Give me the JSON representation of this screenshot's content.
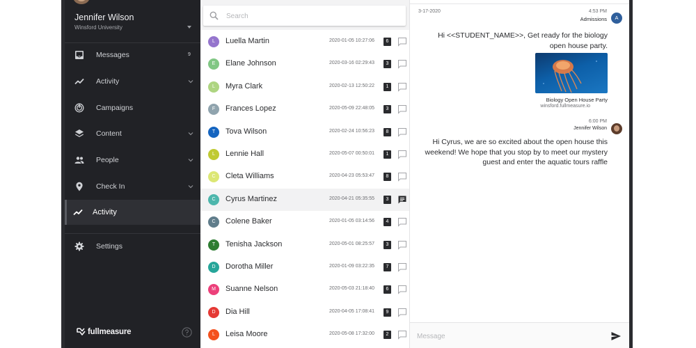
{
  "profile": {
    "name": "Jennifer Wilson",
    "organization": "Winsford University"
  },
  "sidebar": {
    "items": [
      {
        "label": "Messages",
        "icon": "inbox-icon",
        "badge": "9"
      },
      {
        "label": "Activity",
        "icon": "trend-icon",
        "has_chevron": true
      },
      {
        "label": "Campaigns",
        "icon": "campaign-icon"
      },
      {
        "label": "Content",
        "icon": "layers-icon",
        "has_chevron": true
      },
      {
        "label": "People",
        "icon": "people-icon",
        "has_chevron": true
      },
      {
        "label": "Check In",
        "icon": "location-pin-icon",
        "has_chevron": true
      },
      {
        "label": "Activity",
        "icon": "trend-icon",
        "active": true
      },
      {
        "label": "Settings",
        "icon": "gear-icon"
      }
    ],
    "logo_text": "fullmeasure"
  },
  "search": {
    "placeholder": "Search"
  },
  "contacts": [
    {
      "initial": "L",
      "name": "Luella Martin",
      "datetime": "2020-01-05 10:27:06",
      "count": "6",
      "color": "#9575cd"
    },
    {
      "initial": "E",
      "name": "Elane Johnson",
      "datetime": "2020-03-16 02:29:43",
      "count": "3",
      "color": "#81c784"
    },
    {
      "initial": "L",
      "name": "Myra Clark",
      "datetime": "2020-02-13 12:50:22",
      "count": "1",
      "color": "#aed581"
    },
    {
      "initial": "F",
      "name": "Frances Lopez",
      "datetime": "2020-05-09 22:48:05",
      "count": "3",
      "color": "#90a4ae"
    },
    {
      "initial": "T",
      "name": "Tova Wilson",
      "datetime": "2020-02-24 10:56:23",
      "count": "8",
      "color": "#1565c0"
    },
    {
      "initial": "L",
      "name": "Lennie Hall",
      "datetime": "2020-05-07 00:50:01",
      "count": "1",
      "color": "#c0ca33"
    },
    {
      "initial": "C",
      "name": "Cleta Williams",
      "datetime": "2020-04-23 05:53:47",
      "count": "8",
      "color": "#dce775"
    },
    {
      "initial": "C",
      "name": "Cyrus Martinez",
      "datetime": "2020-04-21 05:35:55",
      "count": "3",
      "color": "#4db6ac",
      "selected": true
    },
    {
      "initial": "C",
      "name": "Colene Baker",
      "datetime": "2020-01-05 03:14:56",
      "count": "4",
      "color": "#607d8b"
    },
    {
      "initial": "T",
      "name": "Tenisha Jackson",
      "datetime": "2020-05-01 08:25:57",
      "count": "3",
      "color": "#2e7d32"
    },
    {
      "initial": "D",
      "name": "Dorotha Miller",
      "datetime": "2020-01-09 03:22:35",
      "count": "7",
      "color": "#26a69a"
    },
    {
      "initial": "M",
      "name": "Suanne Nelson",
      "datetime": "2020-05-03 21:18:40",
      "count": "6",
      "color": "#ec407a"
    },
    {
      "initial": "D",
      "name": "Dia Hill",
      "datetime": "2020-04-05 17:08:41",
      "count": "9",
      "color": "#e53935"
    },
    {
      "initial": "L",
      "name": "Leisa Moore",
      "datetime": "2020-05-08 17:32:00",
      "count": "2",
      "color": "#f4511e"
    }
  ],
  "chat": {
    "date": "3-17-2020",
    "messages": [
      {
        "time": "4:53 PM",
        "sender": "Admissions",
        "avatar_initial": "A",
        "text": "Hi <<STUDENT_NAME>>, Get ready for the biology open house party.",
        "attachment_title": "Biology Open House Party",
        "attachment_url": "winsford.fullmeasure.io"
      },
      {
        "time": "6:00 PM",
        "sender": "Jennifer Wilson",
        "text": "Hi Cyrus, we are so excited about the open house this weekend! We hope that you stop by to meet our mystery guest and enter the aquatic tours raffle"
      }
    ],
    "composer_placeholder": "Message"
  },
  "colors": {
    "sidebar_bg": "#212226",
    "accent_blue": "#2f5f9c",
    "badge_dark": "#2a2b2e"
  }
}
